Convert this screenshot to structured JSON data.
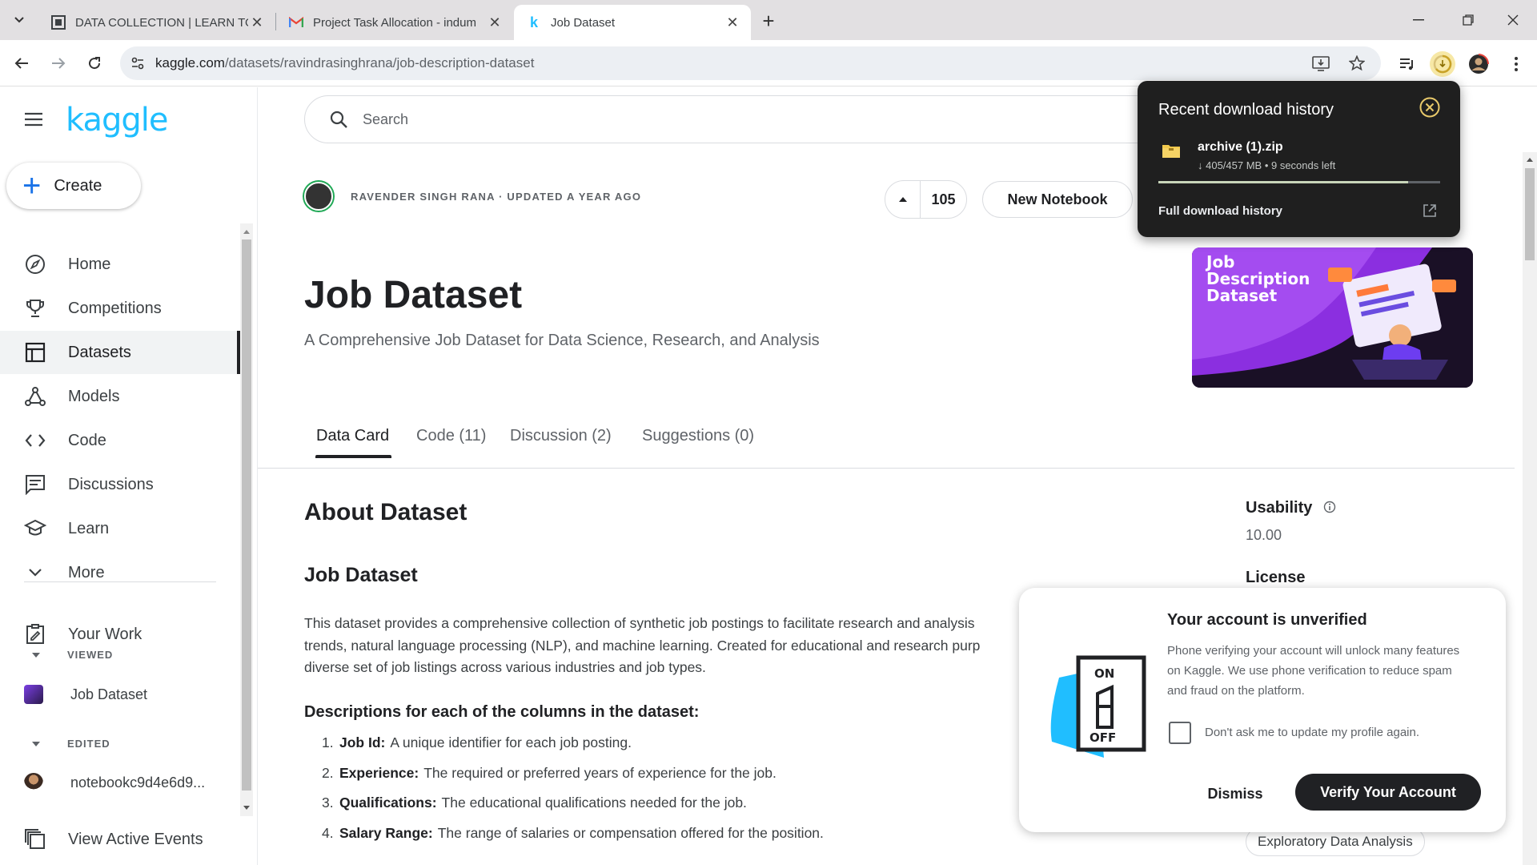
{
  "browser": {
    "tabs": [
      {
        "title": "DATA COLLECTION | LEARN TO",
        "favicon": "square-logo-icon"
      },
      {
        "title": "Project Task Allocation - indum",
        "favicon": "gmail-icon"
      },
      {
        "title": "Job Dataset",
        "favicon": "kaggle-k-icon"
      }
    ],
    "active_tab": 2,
    "url_host": "kaggle.com",
    "url_path": "/datasets/ravindrasinghrana/job-description-dataset"
  },
  "sidebar": {
    "logo": "kaggle",
    "create_label": "Create",
    "items": [
      {
        "label": "Home",
        "icon": "compass-icon"
      },
      {
        "label": "Competitions",
        "icon": "trophy-icon"
      },
      {
        "label": "Datasets",
        "icon": "table-icon"
      },
      {
        "label": "Models",
        "icon": "models-icon"
      },
      {
        "label": "Code",
        "icon": "code-icon"
      },
      {
        "label": "Discussions",
        "icon": "chat-icon"
      },
      {
        "label": "Learn",
        "icon": "school-icon"
      },
      {
        "label": "More",
        "icon": "chevron-down-icon"
      }
    ],
    "selected_item": "Datasets",
    "your_work": "Your Work",
    "viewed_label": "VIEWED",
    "viewed_item": "Job Dataset",
    "edited_label": "EDITED",
    "edited_item": "notebookc9d4e6d9...",
    "view_events": "View Active Events"
  },
  "search": {
    "placeholder": "Search"
  },
  "dataset": {
    "author_line": "RAVENDER SINGH RANA · UPDATED A YEAR AGO",
    "votes": "105",
    "new_notebook": "New Notebook",
    "title": "Job Dataset",
    "subtitle": "A Comprehensive Job Dataset for Data Science, Research, and Analysis",
    "cover_text": [
      "Job",
      "Description",
      "Dataset"
    ]
  },
  "content_tabs": [
    "Data Card",
    "Code (11)",
    "Discussion (2)",
    "Suggestions (0)"
  ],
  "about": {
    "heading": "About Dataset",
    "subheading": "Job Dataset",
    "paragraph_lines": [
      "This dataset provides a comprehensive collection of synthetic job postings to facilitate research and analysis",
      "trends, natural language processing (NLP), and machine learning. Created for educational and research purp",
      "diverse set of job listings across various industries and job types."
    ],
    "columns_heading": "Descriptions for each of the columns in the dataset:",
    "columns": [
      {
        "num": "1.",
        "name": "Job Id:",
        "desc": "A unique identifier for each job posting."
      },
      {
        "num": "2.",
        "name": "Experience:",
        "desc": "The required or preferred years of experience for the job."
      },
      {
        "num": "3.",
        "name": "Qualifications:",
        "desc": "The educational qualifications needed for the job."
      },
      {
        "num": "4.",
        "name": "Salary Range:",
        "desc": "The range of salaries or compensation offered for the position."
      }
    ]
  },
  "side_panel": {
    "usability_label": "Usability",
    "usability_value": "10.00",
    "license_label": "License",
    "tag": "Exploratory Data Analysis"
  },
  "download_bubble": {
    "title": "Recent download history",
    "file_name": "archive (1).zip",
    "file_status": "↓ 405/457 MB • 9 seconds left",
    "progress": 0.886,
    "full_history": "Full download history"
  },
  "verify_dialog": {
    "title": "Your account is unverified",
    "body": "Phone verifying your account will unlock many features on Kaggle. We use phone verification to reduce spam and fraud on the platform.",
    "art_on": "ON",
    "art_off": "OFF",
    "checkbox_label": "Don't ask me to update my profile again.",
    "dismiss": "Dismiss",
    "verify": "Verify Your Account"
  },
  "colors": {
    "kaggle_blue": "#20beff",
    "dark_button": "#202124",
    "download_bg": "#1f1f1f"
  }
}
